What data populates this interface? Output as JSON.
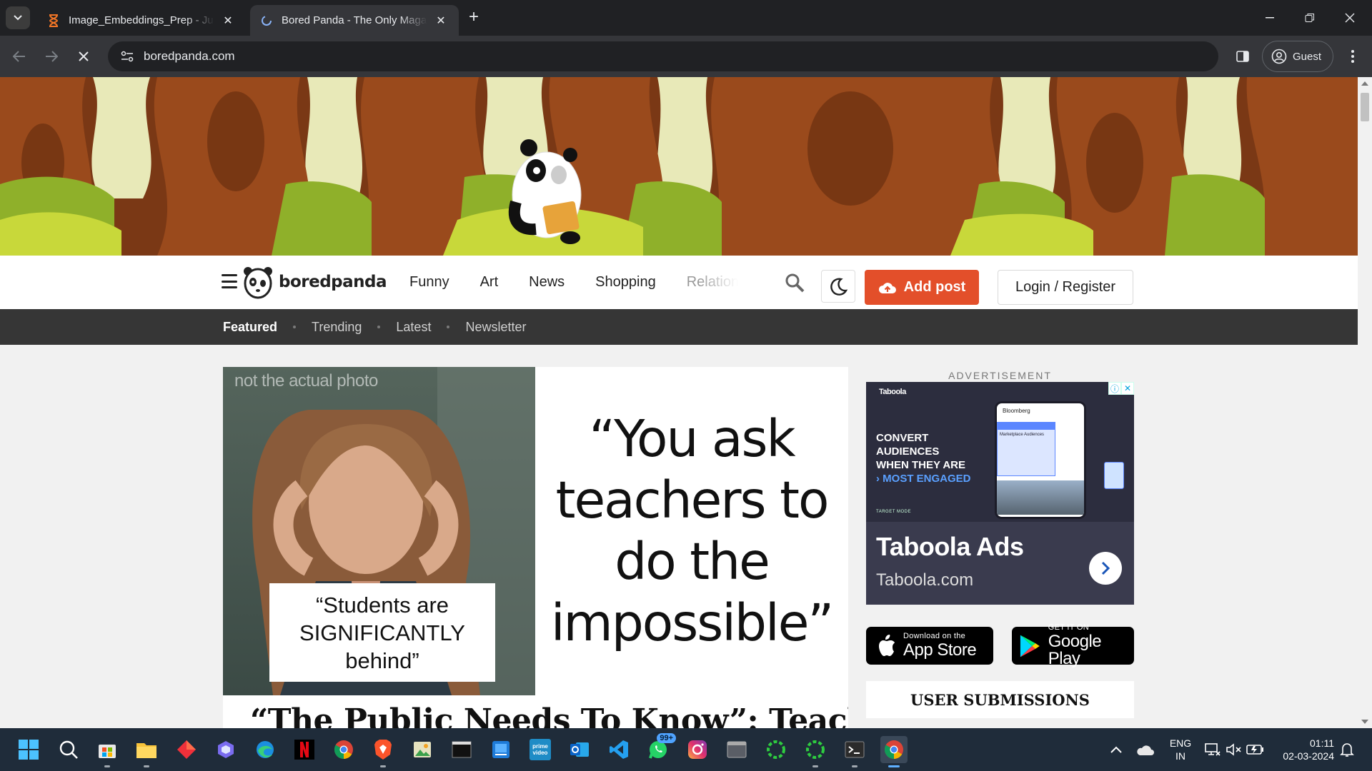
{
  "browser": {
    "tabs": [
      {
        "title": "Image_Embeddings_Prep - Jupy",
        "icon": "hourglass-icon",
        "active": false
      },
      {
        "title": "Bored Panda - The Only Magazi",
        "icon": "loading-spinner-icon",
        "active": true
      }
    ],
    "address": "boredpanda.com",
    "profile_label": "Guest"
  },
  "site": {
    "logo_text": "boredpanda",
    "nav": [
      "Funny",
      "Art",
      "News",
      "Shopping",
      "Relation"
    ],
    "add_post_label": "Add post",
    "login_label": "Login / Register",
    "subnav": [
      "Featured",
      "Trending",
      "Latest",
      "Newsletter"
    ],
    "subnav_active": "Featured",
    "accent_color": "#e34f2a"
  },
  "article": {
    "photo_label": "not the actual photo",
    "quote_left": "“Students are SIGNIFICANTLY behind”",
    "quote_right": "“You ask teachers to do the impossible”",
    "title": "“The Public Needs To Know”: Teacher"
  },
  "ad": {
    "label": "ADVERTISEMENT",
    "brand": "Taboola",
    "copy_lines": [
      "CONVERT",
      "AUDIENCES",
      "WHEN THEY ARE"
    ],
    "copy_highlight": "MOST ENGAGED",
    "phone_brand": "Bloomberg",
    "overlay_title": "Marketplace Audiences",
    "target_mode": "TARGET MODE",
    "title": "Taboola Ads",
    "domain": "Taboola.com"
  },
  "apps": {
    "apple_small": "Download on the",
    "apple_big": "App Store",
    "google_small": "GET IT ON",
    "google_big": "Google Play"
  },
  "sidebar": {
    "user_submissions": "USER SUBMISSIONS"
  },
  "taskbar": {
    "whatsapp_badge": "99+",
    "lang_line1": "ENG",
    "lang_line2": "IN",
    "time": "01:11",
    "date": "02-03-2024"
  }
}
